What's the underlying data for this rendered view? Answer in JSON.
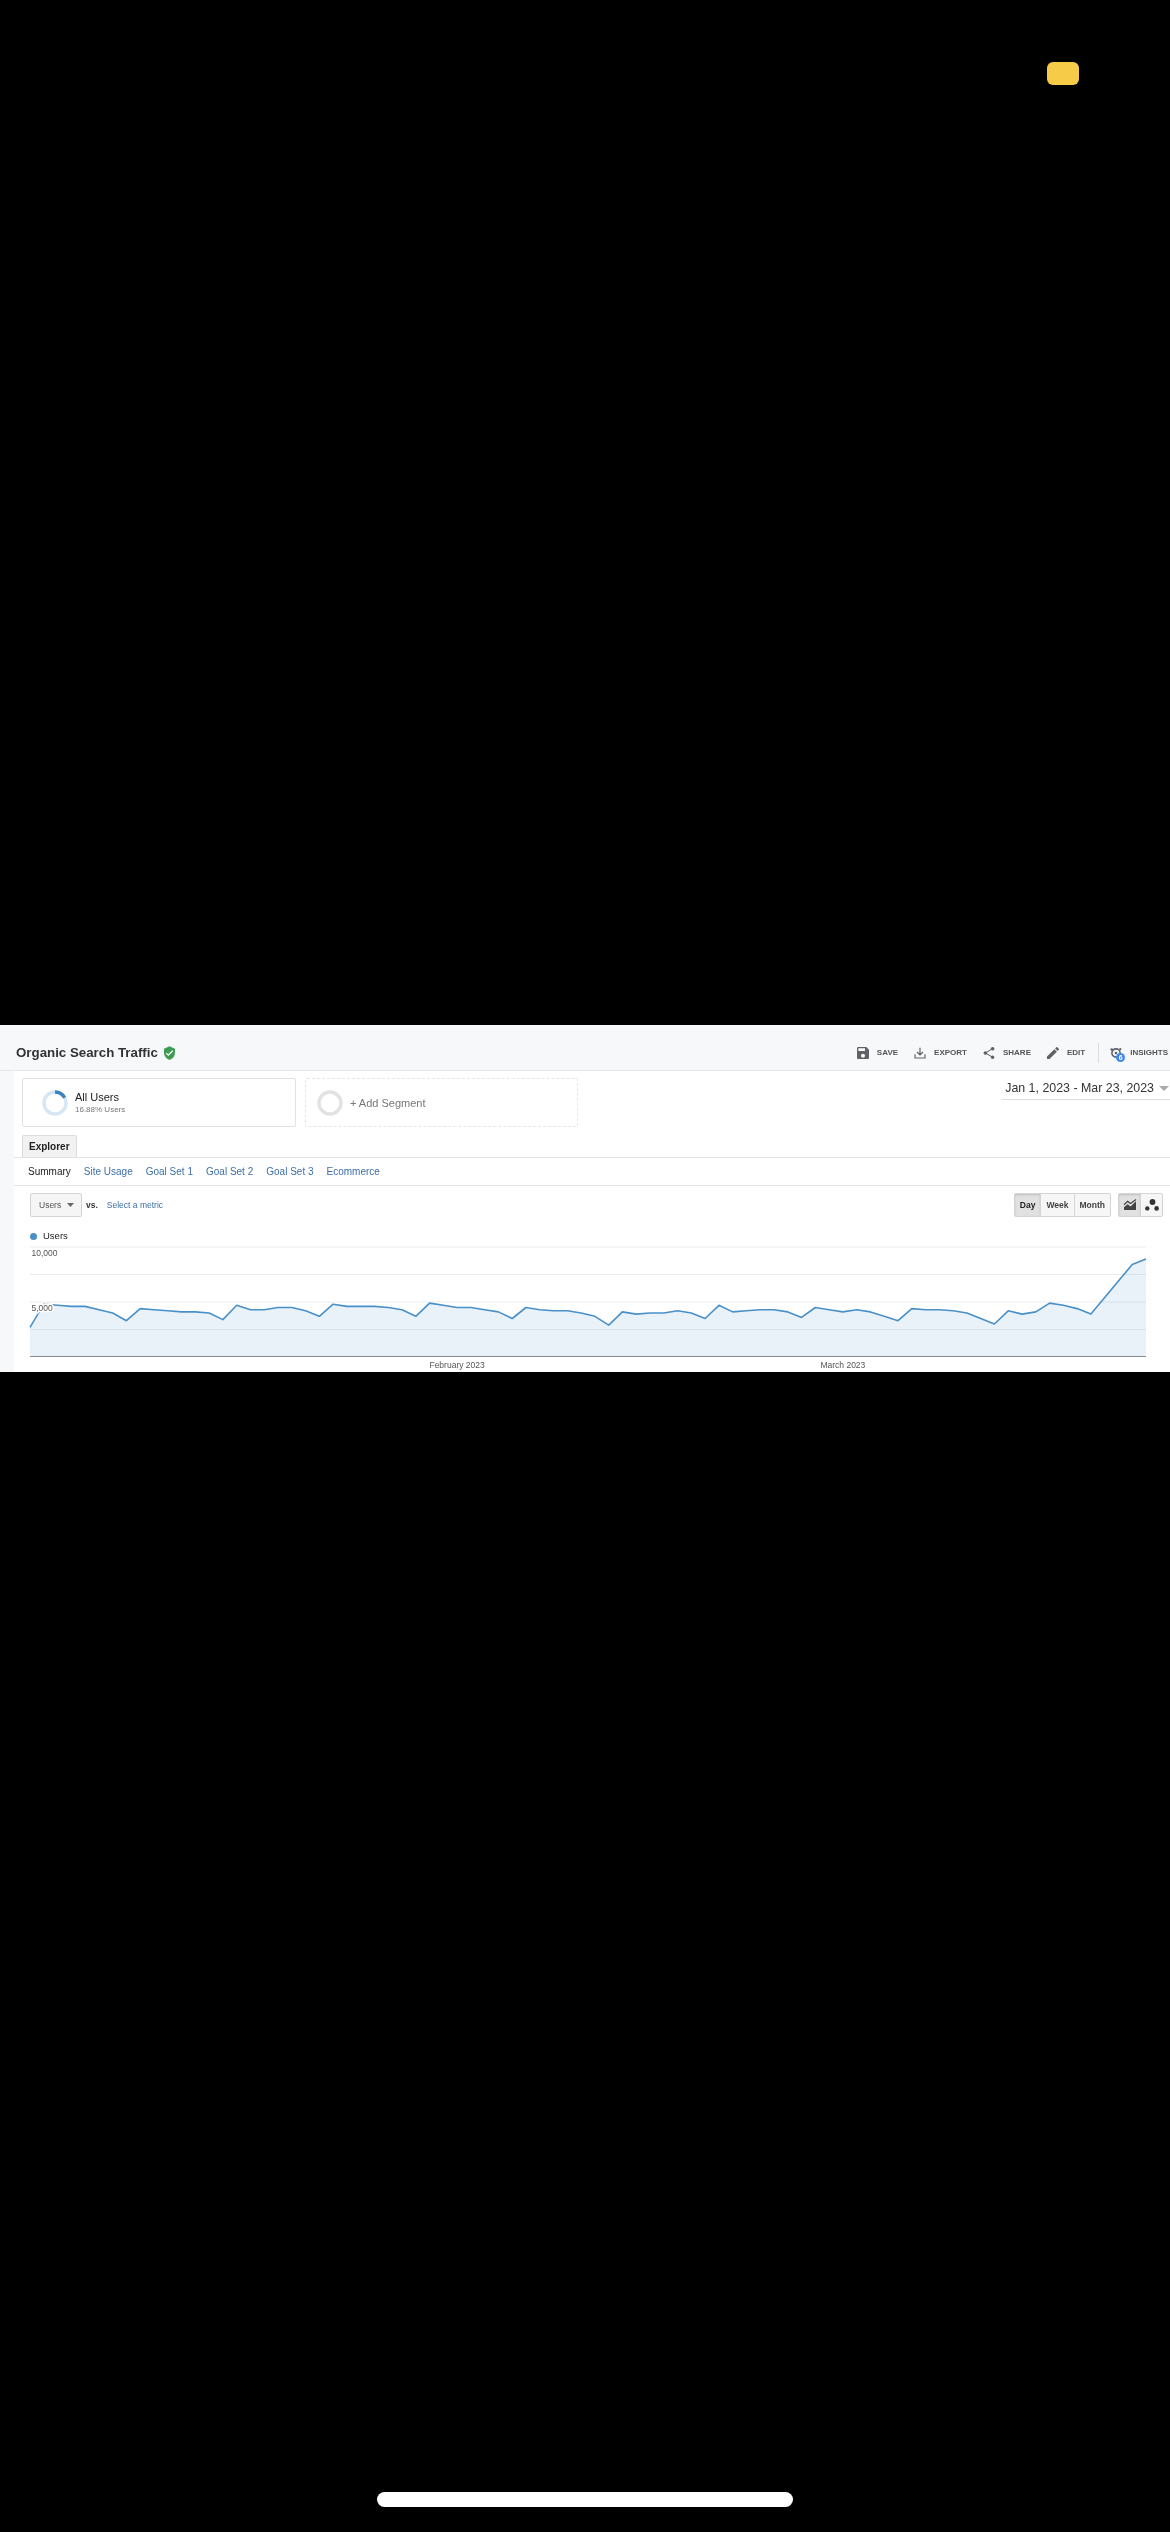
{
  "report": {
    "title": "Organic Search Traffic",
    "toolbar": [
      {
        "kind": "save",
        "label": "SAVE"
      },
      {
        "kind": "export",
        "label": "EXPORT"
      },
      {
        "kind": "share",
        "label": "SHARE"
      },
      {
        "kind": "edit",
        "label": "EDIT"
      },
      {
        "kind": "insights",
        "label": "INSIGHTS",
        "badge": "6"
      }
    ]
  },
  "segments": [
    {
      "kind": "segment",
      "name": "All Users",
      "detail": "16.88% Users",
      "level": 0.1688
    },
    {
      "kind": "add",
      "label": "+ Add Segment"
    }
  ],
  "date_range": {
    "value": "Jan 1, 2023 - Mar 23, 2023"
  },
  "tabs": [
    {
      "label": "Explorer",
      "selected": true
    }
  ],
  "subtabs": [
    {
      "label": "Summary",
      "selected": true
    },
    {
      "label": "Site Usage",
      "selected": false
    },
    {
      "label": "Goal Set 1",
      "selected": false
    },
    {
      "label": "Goal Set 2",
      "selected": false
    },
    {
      "label": "Goal Set 3",
      "selected": false
    },
    {
      "label": "Ecommerce",
      "selected": false
    }
  ],
  "metric": {
    "value": "Users",
    "vs": "vs.",
    "compare_link": "Select a metric"
  },
  "intervals": [
    {
      "label": "Day",
      "selected": true
    },
    {
      "label": "Week",
      "selected": false
    },
    {
      "label": "Month",
      "selected": false
    }
  ],
  "chart_types": [
    {
      "kind": "line",
      "selected": true
    },
    {
      "kind": "motion",
      "selected": false
    }
  ],
  "chart": {
    "chart_data": {
      "type": "area",
      "categories": [
        null,
        null,
        null,
        null,
        null,
        null,
        null,
        null,
        null,
        null,
        null,
        null,
        null,
        null,
        null,
        null,
        null,
        null,
        null,
        null,
        null,
        null,
        null,
        null,
        null,
        null,
        null,
        null,
        null,
        null,
        null,
        "February 2023",
        null,
        null,
        null,
        null,
        null,
        null,
        null,
        null,
        null,
        null,
        null,
        null,
        null,
        null,
        null,
        null,
        null,
        null,
        null,
        null,
        null,
        null,
        null,
        null,
        null,
        null,
        null,
        "March 2023",
        null,
        null,
        null,
        null,
        null,
        null,
        null,
        null,
        null,
        null,
        null,
        null,
        null,
        null,
        null,
        null,
        null,
        null,
        null,
        null,
        null,
        null
      ],
      "series": [
        {
          "name": "Users",
          "color": "#4a90c8",
          "values": [
            2700,
            4800,
            4700,
            4600,
            4600,
            4300,
            4000,
            3300,
            4400,
            4300,
            4200,
            4100,
            4100,
            4000,
            3400,
            4700,
            4300,
            4300,
            4500,
            4500,
            4200,
            3700,
            4800,
            4600,
            4600,
            4600,
            4500,
            4300,
            3700,
            4900,
            4700,
            4500,
            4500,
            4300,
            4100,
            3500,
            4500,
            4300,
            4200,
            4200,
            4000,
            3700,
            2900,
            4100,
            3900,
            4000,
            4000,
            4200,
            4000,
            3500,
            4700,
            4100,
            4200,
            4300,
            4300,
            4100,
            3600,
            4500,
            4300,
            4100,
            4300,
            4100,
            3700,
            3300,
            4400,
            4300,
            4300,
            4200,
            4000,
            3500,
            3000,
            4200,
            3900,
            4100,
            4900,
            4700,
            4400,
            3900,
            5400,
            6900,
            8400,
            8900
          ]
        }
      ],
      "ylim": [
        0,
        10000
      ],
      "yticks": [
        {
          "value": 5000,
          "label": "5,000"
        },
        {
          "value": 10000,
          "label": "10,000"
        }
      ]
    }
  }
}
